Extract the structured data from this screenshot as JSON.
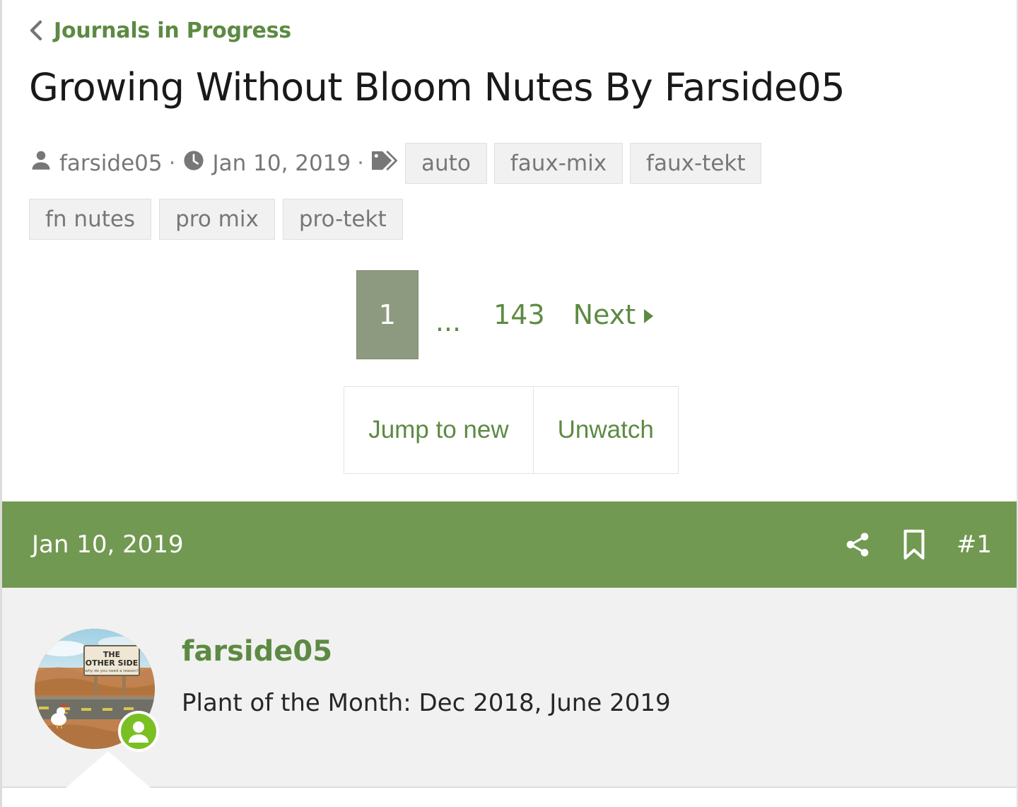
{
  "breadcrumb": {
    "back_icon": "chevron-left-icon",
    "label": "Journals in Progress"
  },
  "title": "Growing Without Bloom Nutes By Farside05",
  "meta": {
    "author_icon": "user-icon",
    "author": "farside05",
    "separator": "·",
    "date_icon": "clock-icon",
    "date": "Jan 10, 2019",
    "tags_icon": "tags-icon",
    "tags_row1": [
      "auto",
      "faux-mix",
      "faux-tekt"
    ],
    "tags_row2": [
      "fn nutes",
      "pro mix",
      "pro-tekt"
    ]
  },
  "pagination": {
    "current_page": "1",
    "gap": "...",
    "last_page": "143",
    "next_label": "Next",
    "next_icon": "caret-right-icon"
  },
  "actions": {
    "jump_to_new": "Jump to new",
    "unwatch": "Unwatch"
  },
  "post": {
    "date": "Jan 10, 2019",
    "share_icon": "share-icon",
    "bookmark_icon": "bookmark-icon",
    "number": "#1",
    "author": "farside05",
    "author_subtitle": "Plant of the Month: Dec 2018, June 2019",
    "avatar_icon": "avatar-image",
    "avatar_sign_line1": "THE",
    "avatar_sign_line2": "OTHER SIDE",
    "online_badge_icon": "online-status-icon"
  },
  "colors": {
    "accent_green": "#5d8a43",
    "header_green": "#719951",
    "active_page_bg": "#8d9a80",
    "body_gray": "#f1f1f1",
    "tag_bg": "#f1f1f1",
    "muted_text": "#777777",
    "online_green": "#7ac023"
  }
}
